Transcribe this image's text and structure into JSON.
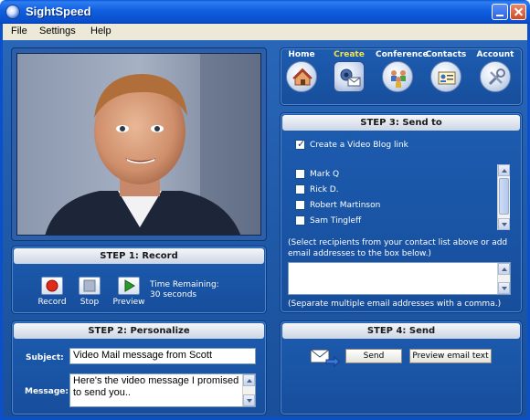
{
  "window": {
    "title": "SightSpeed"
  },
  "menu": [
    "File",
    "Settings",
    "Help"
  ],
  "nav": [
    {
      "label": "Home",
      "icon": "home-icon",
      "active": false
    },
    {
      "label": "Create",
      "icon": "video-mail-icon",
      "active": true
    },
    {
      "label": "Conference",
      "icon": "conference-icon",
      "active": false
    },
    {
      "label": "Contacts",
      "icon": "contacts-icon",
      "active": false
    },
    {
      "label": "Account",
      "icon": "account-icon",
      "active": false
    }
  ],
  "step1": {
    "title": "STEP 1: Record",
    "record_label": "Record",
    "stop_label": "Stop",
    "preview_label": "Preview",
    "time_label": "Time Remaining:",
    "time_value": "30 seconds"
  },
  "step2": {
    "title": "STEP 2: Personalize",
    "subject_label": "Subject:",
    "subject_value": "Video Mail message from Scott",
    "message_label": "Message:",
    "message_value": "Here's the video message I promised to send you.."
  },
  "step3": {
    "title": "STEP 3: Send to",
    "blog_label": "Create a Video Blog link",
    "contacts": [
      {
        "name": "Mark Q",
        "checked": false
      },
      {
        "name": "Rick D.",
        "checked": false
      },
      {
        "name": "Robert Martinson",
        "checked": false
      },
      {
        "name": "Sam Tingleff",
        "checked": false
      }
    ],
    "hint1": "(Select recipients from your contact list above or add email addresses to the box below.)",
    "hint2": "(Separate multiple email addresses with a comma.)"
  },
  "step4": {
    "title": "STEP 4: Send",
    "send_label": "Send",
    "preview_email_label": "Preview email text"
  }
}
